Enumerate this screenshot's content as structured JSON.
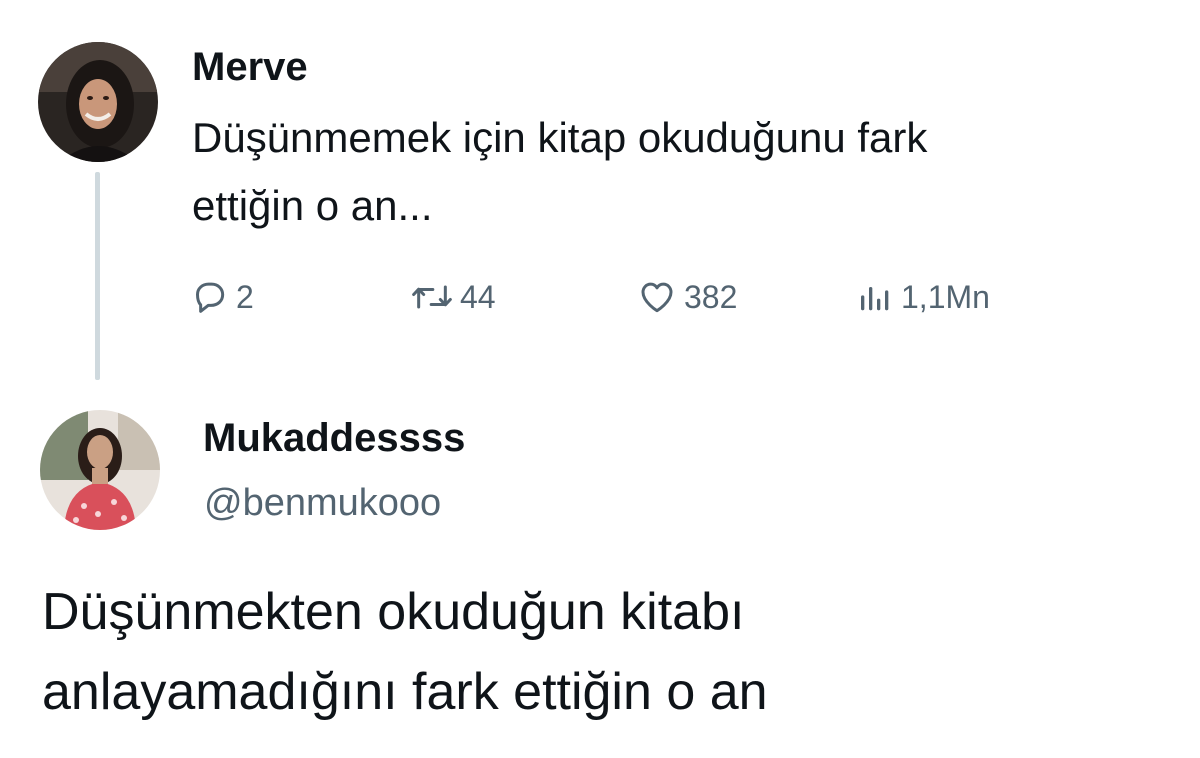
{
  "reply_tweet": {
    "author_name": "Merve",
    "text_lines": [
      "Düşünmemek için kitap okuduğunu fark",
      "ettiğin o an..."
    ],
    "stats": {
      "replies": "2",
      "reposts": "44",
      "likes": "382",
      "views": "1,1Mn"
    },
    "icons": {
      "reply": "speech-bubble-icon",
      "repost": "repost-arrows-icon",
      "like": "heart-icon",
      "views": "bar-chart-icon"
    }
  },
  "quote_tweet": {
    "author_name": "Mukaddessss",
    "handle": "@benmukooo",
    "text_lines": [
      "Düşünmekten okuduğun kitabı",
      "anlayamadığını fark ettiğin o an"
    ]
  },
  "colors": {
    "text_primary": "#0f1419",
    "text_secondary": "#536471",
    "thread_line": "#cfd9de",
    "background": "#ffffff"
  }
}
